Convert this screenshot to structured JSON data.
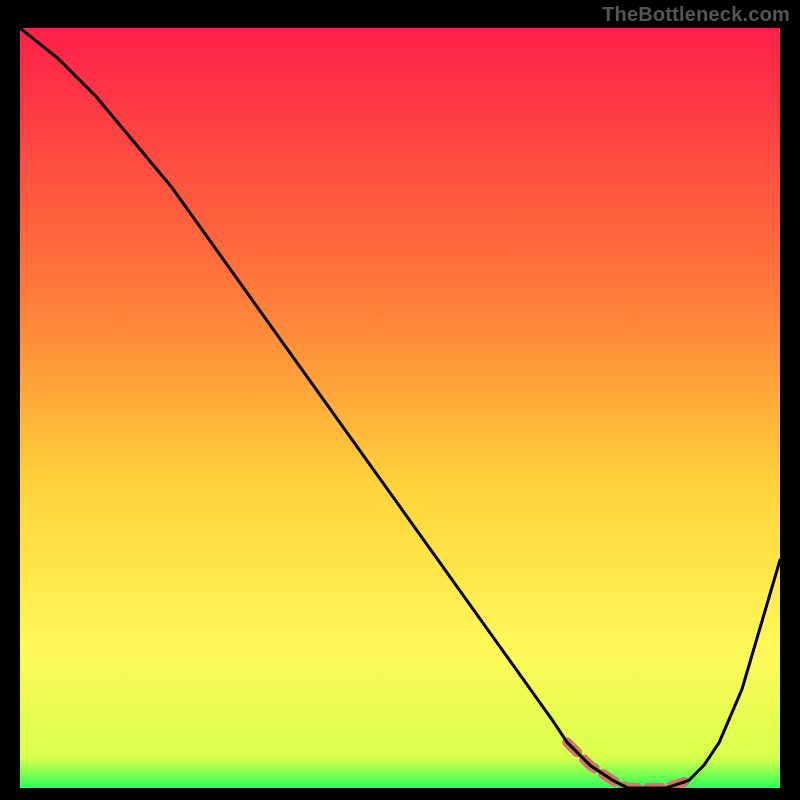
{
  "watermark": "TheBottleneck.com",
  "colors": {
    "bg": "#000000",
    "curve": "#000000",
    "highlight": "#d1766e",
    "gradient_top": "#ff1f4a",
    "gradient_mid1": "#ff7a3a",
    "gradient_mid2": "#ffd23a",
    "gradient_mid3": "#fff95a",
    "gradient_bottom": "#2cff5a"
  },
  "chart_data": {
    "type": "line",
    "title": "",
    "xlabel": "",
    "ylabel": "",
    "xlim": [
      0,
      100
    ],
    "ylim": [
      0,
      100
    ],
    "x": [
      0,
      5,
      10,
      15,
      20,
      25,
      30,
      35,
      40,
      45,
      50,
      55,
      60,
      65,
      70,
      72,
      75,
      78,
      80,
      82,
      85,
      88,
      90,
      92,
      95,
      100
    ],
    "values": [
      100,
      96,
      91,
      85,
      79,
      72,
      65,
      58,
      51,
      44,
      37,
      30,
      23,
      16,
      9,
      6,
      3,
      1,
      0,
      0,
      0,
      1,
      3,
      6,
      13,
      30
    ],
    "highlight_range_x": [
      72,
      88
    ],
    "gradient_stops": [
      {
        "pos": 0.0,
        "color": "#ff1f4a"
      },
      {
        "pos": 0.35,
        "color": "#ff7a3a"
      },
      {
        "pos": 0.6,
        "color": "#ffd23a"
      },
      {
        "pos": 0.82,
        "color": "#fff95a"
      },
      {
        "pos": 0.96,
        "color": "#d9ff4a"
      },
      {
        "pos": 1.0,
        "color": "#2cff5a"
      }
    ]
  }
}
